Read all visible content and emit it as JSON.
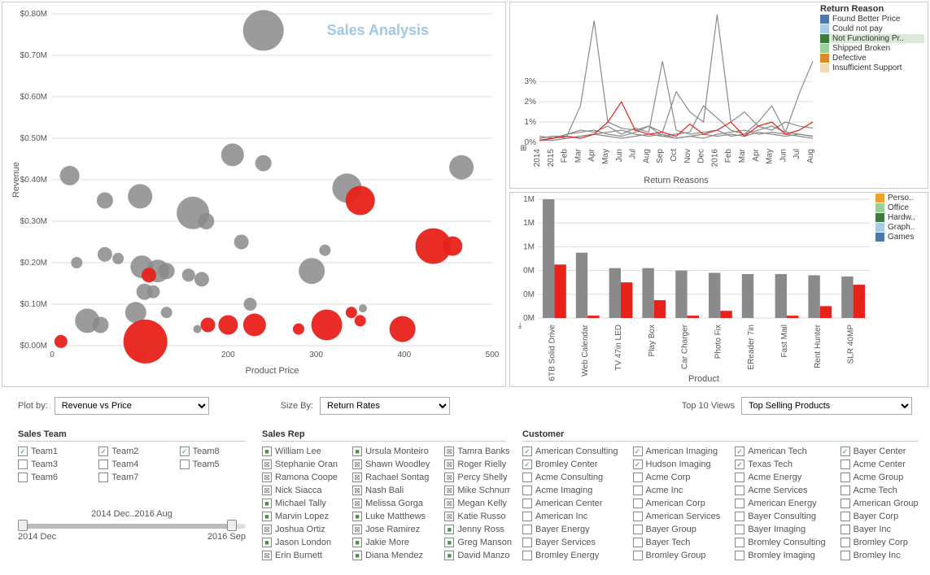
{
  "chart_data": [
    {
      "type": "scatter",
      "title": "Sales Analysis",
      "xlabel": "Product Price",
      "ylabel": "Revenue",
      "xlim": [
        0,
        500
      ],
      "ylim": [
        0,
        0.8
      ],
      "y_unit": "M",
      "y_prefix": "$",
      "x_ticks": [
        0,
        100,
        200,
        300,
        400,
        500
      ],
      "y_ticks": [
        0.0,
        0.1,
        0.2,
        0.3,
        0.4,
        0.5,
        0.6,
        0.7,
        0.8
      ],
      "size_by": "Return Rates",
      "series": [
        {
          "name": "gray",
          "points": [
            {
              "x": 240,
              "y": 0.76,
              "r": 25
            },
            {
              "x": 205,
              "y": 0.46,
              "r": 14
            },
            {
              "x": 240,
              "y": 0.44,
              "r": 10
            },
            {
              "x": 465,
              "y": 0.43,
              "r": 15
            },
            {
              "x": 20,
              "y": 0.41,
              "r": 12
            },
            {
              "x": 335,
              "y": 0.38,
              "r": 18
            },
            {
              "x": 100,
              "y": 0.36,
              "r": 15
            },
            {
              "x": 60,
              "y": 0.35,
              "r": 10
            },
            {
              "x": 160,
              "y": 0.32,
              "r": 20
            },
            {
              "x": 175,
              "y": 0.3,
              "r": 10
            },
            {
              "x": 215,
              "y": 0.25,
              "r": 9
            },
            {
              "x": 60,
              "y": 0.22,
              "r": 9
            },
            {
              "x": 75,
              "y": 0.21,
              "r": 7
            },
            {
              "x": 28,
              "y": 0.2,
              "r": 7
            },
            {
              "x": 102,
              "y": 0.19,
              "r": 14
            },
            {
              "x": 120,
              "y": 0.18,
              "r": 14
            },
            {
              "x": 130,
              "y": 0.18,
              "r": 10
            },
            {
              "x": 155,
              "y": 0.17,
              "r": 8
            },
            {
              "x": 170,
              "y": 0.16,
              "r": 9
            },
            {
              "x": 295,
              "y": 0.18,
              "r": 16
            },
            {
              "x": 105,
              "y": 0.13,
              "r": 10
            },
            {
              "x": 115,
              "y": 0.13,
              "r": 8
            },
            {
              "x": 225,
              "y": 0.1,
              "r": 8
            },
            {
              "x": 130,
              "y": 0.08,
              "r": 7
            },
            {
              "x": 95,
              "y": 0.08,
              "r": 13
            },
            {
              "x": 40,
              "y": 0.06,
              "r": 15
            },
            {
              "x": 55,
              "y": 0.05,
              "r": 10
            },
            {
              "x": 165,
              "y": 0.04,
              "r": 5
            },
            {
              "x": 310,
              "y": 0.23,
              "r": 7
            },
            {
              "x": 353,
              "y": 0.09,
              "r": 5
            }
          ]
        },
        {
          "name": "red",
          "points": [
            {
              "x": 350,
              "y": 0.35,
              "r": 18
            },
            {
              "x": 110,
              "y": 0.17,
              "r": 9
            },
            {
              "x": 433,
              "y": 0.24,
              "r": 22
            },
            {
              "x": 455,
              "y": 0.24,
              "r": 12
            },
            {
              "x": 312,
              "y": 0.05,
              "r": 19
            },
            {
              "x": 200,
              "y": 0.05,
              "r": 12
            },
            {
              "x": 177,
              "y": 0.05,
              "r": 9
            },
            {
              "x": 230,
              "y": 0.05,
              "r": 14
            },
            {
              "x": 280,
              "y": 0.04,
              "r": 7
            },
            {
              "x": 340,
              "y": 0.08,
              "r": 7
            },
            {
              "x": 350,
              "y": 0.06,
              "r": 7
            },
            {
              "x": 106,
              "y": 0.01,
              "r": 27
            },
            {
              "x": 10,
              "y": 0.01,
              "r": 8
            },
            {
              "x": 398,
              "y": 0.04,
              "r": 16
            }
          ]
        }
      ]
    },
    {
      "type": "line",
      "title": "",
      "xlabel": "Return Reasons",
      "ylabel": "",
      "ylim": [
        0,
        6
      ],
      "y_ticks_pct": [
        0,
        1,
        2,
        3
      ],
      "x_categories": [
        "2014",
        "2015",
        "Feb",
        "Mar",
        "Apr",
        "May",
        "Jun",
        "Jul",
        "Aug",
        "Sep",
        "Oct",
        "Nov",
        "Dec",
        "2016",
        "Feb",
        "Mar",
        "Apr",
        "May",
        "Jun",
        "Jul",
        "Aug"
      ],
      "legend_title": "Return Reason",
      "legend": [
        {
          "label": "Found Better Price",
          "color": "#4e79a7"
        },
        {
          "label": "Could not pay",
          "color": "#a9cbe6"
        },
        {
          "label": "Not Functioning Pr..",
          "color": "#3f7a3f",
          "highlight": true
        },
        {
          "label": "Shipped Broken",
          "color": "#9bcf9b"
        },
        {
          "label": "Defective",
          "color": "#d98b2b"
        },
        {
          "label": "Insufficient Support",
          "color": "#f0dcb4"
        }
      ],
      "series_gray": [
        [
          0.2,
          0.3,
          0.3,
          1.8,
          6.0,
          1.0,
          0.7,
          0.6,
          0.8,
          0.5,
          2.5,
          1.5,
          1.0,
          6.3,
          1.0,
          1.5,
          0.8,
          0.6,
          1.0,
          0.8,
          0.7
        ],
        [
          0.1,
          0.2,
          0.4,
          0.5,
          0.6,
          0.4,
          0.3,
          0.5,
          0.8,
          0.3,
          0.4,
          0.5,
          1.8,
          1.2,
          0.6,
          0.4,
          1.0,
          1.8,
          0.5,
          2.4,
          4.0
        ],
        [
          0.3,
          0.2,
          0.4,
          0.6,
          0.5,
          0.8,
          0.4,
          0.7,
          0.5,
          4.0,
          0.6,
          0.4,
          0.5,
          0.6,
          0.3,
          0.4,
          0.6,
          0.8,
          0.5,
          0.4,
          0.3
        ],
        [
          0.2,
          0.3,
          0.2,
          0.3,
          0.4,
          0.3,
          0.2,
          0.3,
          0.4,
          0.3,
          0.2,
          0.3,
          0.4,
          0.3,
          0.4,
          0.3,
          0.5,
          0.4,
          0.3,
          0.4,
          0.3
        ],
        [
          0.1,
          0.1,
          0.2,
          0.3,
          0.4,
          0.5,
          0.6,
          0.4,
          0.3,
          0.4,
          0.2,
          0.3,
          0.2,
          0.4,
          0.5,
          0.6,
          0.4,
          0.5,
          0.4,
          0.3,
          0.2
        ]
      ],
      "series_red": [
        0.1,
        0.2,
        0.3,
        0.2,
        0.4,
        1.0,
        2.0,
        0.6,
        0.4,
        0.5,
        0.3,
        0.9,
        0.4,
        0.6,
        1.0,
        0.3,
        0.8,
        1.0,
        0.4,
        0.6,
        1.0
      ]
    },
    {
      "type": "bar",
      "xlabel": "Product",
      "ylabel": "",
      "y_ticks": [
        "0M",
        "0M",
        "0M",
        "1M",
        "1M",
        "1M"
      ],
      "legend": [
        {
          "label": "Perso..",
          "color": "#f0a030"
        },
        {
          "label": "Office",
          "color": "#9bcf9b"
        },
        {
          "label": "Hardw..",
          "color": "#3f7a3f"
        },
        {
          "label": "Graph..",
          "color": "#a9cbe6"
        },
        {
          "label": "Games",
          "color": "#4e79a7"
        }
      ],
      "categories": [
        "6TB Solid Drive",
        "Web Calendar",
        "TV 47in LED",
        "Play Box",
        "Car Charger",
        "Photo Fix",
        "EReader 7in",
        "Fast Mail",
        "Rent Hunter",
        "SLR 40MP"
      ],
      "series": [
        {
          "name": "gray",
          "values": [
            1.0,
            0.55,
            0.42,
            0.42,
            0.4,
            0.38,
            0.37,
            0.37,
            0.36,
            0.35
          ]
        },
        {
          "name": "red",
          "values": [
            0.45,
            0.02,
            0.3,
            0.15,
            0.02,
            0.06,
            0.0,
            0.02,
            0.1,
            0.28
          ]
        }
      ]
    }
  ],
  "controls": {
    "plot_by": {
      "label": "Plot by:",
      "value": "Revenue vs Price"
    },
    "size_by": {
      "label": "Size By:",
      "value": "Return Rates"
    },
    "top10": {
      "label": "Top 10 Views",
      "value": "Top Selling Products"
    }
  },
  "filters": {
    "team_title": "Sales Team",
    "teams": [
      {
        "label": "Team1",
        "checked": true,
        "mark": "✓"
      },
      {
        "label": "Team3",
        "checked": false,
        "mark": ""
      },
      {
        "label": "Team6",
        "checked": false,
        "mark": ""
      },
      {
        "label": "Team2",
        "checked": true,
        "mark": "✓"
      },
      {
        "label": "Team4",
        "checked": false,
        "mark": ""
      },
      {
        "label": "Team7",
        "checked": false,
        "mark": ""
      },
      {
        "label": "Team8",
        "checked": true,
        "mark": "✓"
      },
      {
        "label": "Team5",
        "checked": false,
        "mark": ""
      }
    ],
    "rep_title": "Sales Rep",
    "reps": [
      {
        "label": "William Lee",
        "mark": "■",
        "cls": "green"
      },
      {
        "label": "Stephanie Oran",
        "mark": "⊠",
        "cls": "gray"
      },
      {
        "label": "Ramona Coope",
        "mark": "⊠",
        "cls": "gray"
      },
      {
        "label": "Nick Siacca",
        "mark": "⊠",
        "cls": "gray"
      },
      {
        "label": "Michael Tally",
        "mark": "■",
        "cls": "green"
      },
      {
        "label": "Marvin Lopez",
        "mark": "■",
        "cls": "green"
      },
      {
        "label": "Joshua Ortiz",
        "mark": "⊠",
        "cls": "gray"
      },
      {
        "label": "Jason London",
        "mark": "■",
        "cls": "green"
      },
      {
        "label": "Erin Burnett",
        "mark": "⊠",
        "cls": "gray"
      },
      {
        "label": "Ursula Monteiro",
        "mark": "■",
        "cls": "green"
      },
      {
        "label": "Shawn Woodley",
        "mark": "⊠",
        "cls": "gray"
      },
      {
        "label": "Rachael Sontag",
        "mark": "⊠",
        "cls": "gray"
      },
      {
        "label": "Nash Bali",
        "mark": "⊠",
        "cls": "gray"
      },
      {
        "label": "Melissa Gorga",
        "mark": "⊠",
        "cls": "gray"
      },
      {
        "label": "Luke Matthews",
        "mark": "■",
        "cls": "green"
      },
      {
        "label": "Jose Ramirez",
        "mark": "⊠",
        "cls": "gray"
      },
      {
        "label": "Jakie More",
        "mark": "■",
        "cls": "green"
      },
      {
        "label": "Diana Mendez",
        "mark": "■",
        "cls": "green"
      },
      {
        "label": "Tamra Banks",
        "mark": "⊠",
        "cls": "gray"
      },
      {
        "label": "Roger Rielly",
        "mark": "⊠",
        "cls": "gray"
      },
      {
        "label": "Percy Shelly",
        "mark": "⊠",
        "cls": "gray"
      },
      {
        "label": "Mike Schnurr",
        "mark": "⊠",
        "cls": "gray"
      },
      {
        "label": "Megan Kelly",
        "mark": "⊠",
        "cls": "gray"
      },
      {
        "label": "Katie Russo",
        "mark": "⊠",
        "cls": "gray"
      },
      {
        "label": "Jenny Ross",
        "mark": "■",
        "cls": "green"
      },
      {
        "label": "Greg Manson",
        "mark": "■",
        "cls": "green"
      },
      {
        "label": "David Manzo",
        "mark": "■",
        "cls": "green"
      }
    ],
    "cust_title": "Customer",
    "customers": [
      {
        "label": "American Consulting",
        "mark": "✓",
        "cls": "green"
      },
      {
        "label": "Bromley Center",
        "mark": "✓",
        "cls": "green"
      },
      {
        "label": "Acme Consulting",
        "mark": "",
        "cls": ""
      },
      {
        "label": "Acme Imaging",
        "mark": "",
        "cls": ""
      },
      {
        "label": "American Center",
        "mark": "",
        "cls": ""
      },
      {
        "label": "American Inc",
        "mark": "",
        "cls": ""
      },
      {
        "label": "Bayer Energy",
        "mark": "",
        "cls": ""
      },
      {
        "label": "Bayer Services",
        "mark": "",
        "cls": ""
      },
      {
        "label": "Bromley Energy",
        "mark": "",
        "cls": ""
      },
      {
        "label": "American Imaging",
        "mark": "✓",
        "cls": "green"
      },
      {
        "label": "Hudson Imaging",
        "mark": "✓",
        "cls": "green"
      },
      {
        "label": "Acme Corp",
        "mark": "",
        "cls": ""
      },
      {
        "label": "Acme Inc",
        "mark": "",
        "cls": ""
      },
      {
        "label": "American Corp",
        "mark": "",
        "cls": ""
      },
      {
        "label": "American Services",
        "mark": "",
        "cls": ""
      },
      {
        "label": "Bayer Group",
        "mark": "",
        "cls": ""
      },
      {
        "label": "Bayer Tech",
        "mark": "",
        "cls": ""
      },
      {
        "label": "Bromley Group",
        "mark": "",
        "cls": ""
      },
      {
        "label": "American Tech",
        "mark": "✓",
        "cls": "green"
      },
      {
        "label": "Texas Tech",
        "mark": "✓",
        "cls": "green"
      },
      {
        "label": "Acme Energy",
        "mark": "",
        "cls": ""
      },
      {
        "label": "Acme Services",
        "mark": "",
        "cls": ""
      },
      {
        "label": "American Energy",
        "mark": "",
        "cls": ""
      },
      {
        "label": "Bayer Consulting",
        "mark": "",
        "cls": ""
      },
      {
        "label": "Bayer Imaging",
        "mark": "",
        "cls": ""
      },
      {
        "label": "Bromley Consulting",
        "mark": "",
        "cls": ""
      },
      {
        "label": "Bromley Imaging",
        "mark": "",
        "cls": ""
      },
      {
        "label": "Bayer Center",
        "mark": "✓",
        "cls": "green"
      },
      {
        "label": "Acme Center",
        "mark": "",
        "cls": ""
      },
      {
        "label": "Acme Group",
        "mark": "",
        "cls": ""
      },
      {
        "label": "Acme Tech",
        "mark": "",
        "cls": ""
      },
      {
        "label": "American Group",
        "mark": "",
        "cls": ""
      },
      {
        "label": "Bayer Corp",
        "mark": "",
        "cls": ""
      },
      {
        "label": "Bayer Inc",
        "mark": "",
        "cls": ""
      },
      {
        "label": "Bromley Corp",
        "mark": "",
        "cls": ""
      },
      {
        "label": "Bromley Inc",
        "mark": "",
        "cls": ""
      }
    ]
  },
  "slider": {
    "caption": "2014 Dec..2016 Aug",
    "min_label": "2014 Dec",
    "max_label": "2016 Sep"
  }
}
